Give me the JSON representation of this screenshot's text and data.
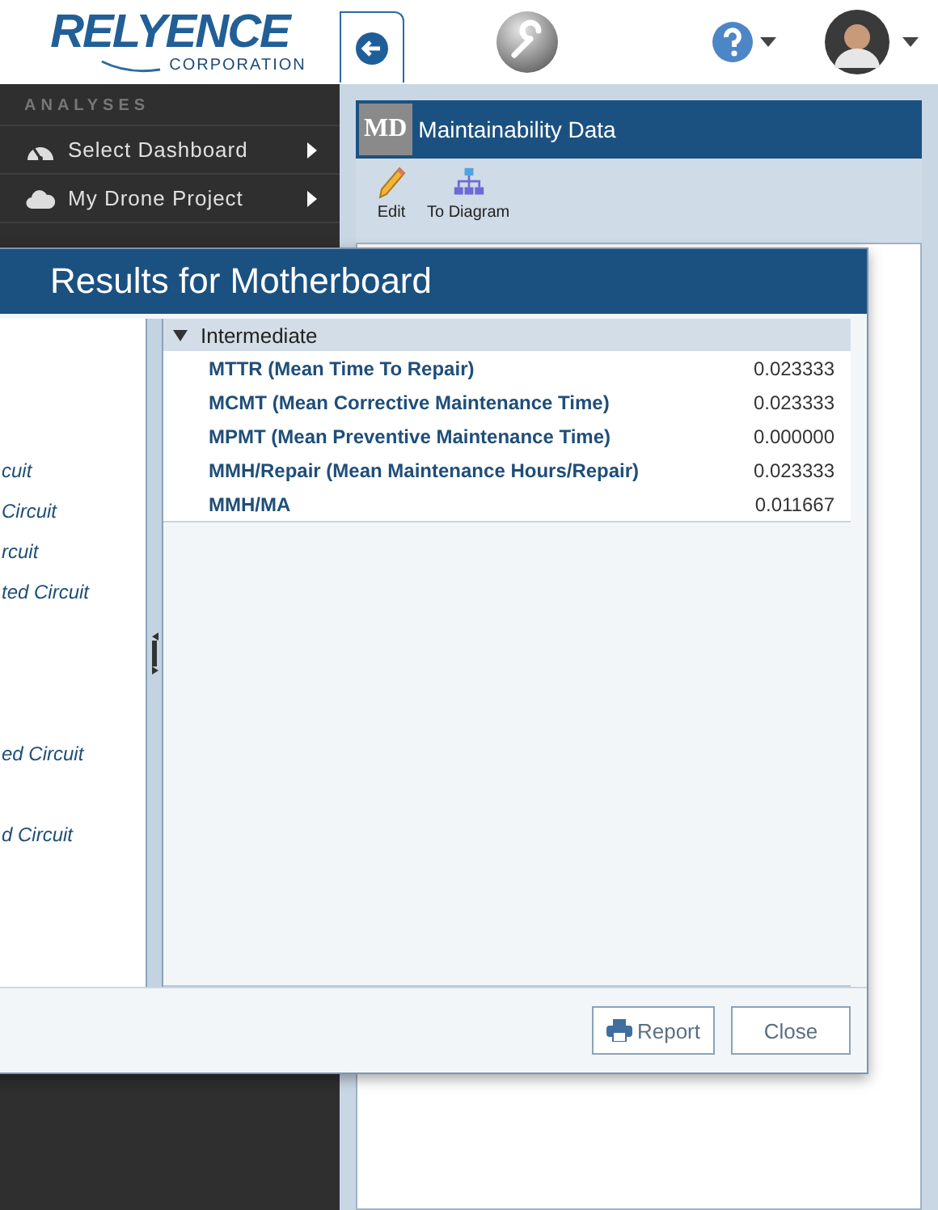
{
  "header": {
    "logo": "RELYENCE",
    "logo_sub": "CORPORATION"
  },
  "sidebar": {
    "sections": [
      {
        "title": "ANALYSES",
        "items": [
          {
            "label": "Select Dashboard"
          },
          {
            "label": "My Drone Project"
          }
        ]
      }
    ]
  },
  "panel": {
    "badge": "MD",
    "title": "Maintainability Data",
    "tools": [
      {
        "label": "Edit"
      },
      {
        "label": "To Diagram"
      }
    ]
  },
  "dialog": {
    "title": "Results for Motherboard",
    "tree_items": [
      "cuit",
      "Circuit",
      "rcuit",
      "ted Circuit",
      "ed Circuit",
      "d Circuit"
    ],
    "group": {
      "label": "Intermediate",
      "expanded": true,
      "rows": [
        {
          "name": "MTTR (Mean Time To Repair)",
          "value": "0.023333"
        },
        {
          "name": "MCMT (Mean Corrective Maintenance Time)",
          "value": "0.023333"
        },
        {
          "name": "MPMT (Mean Preventive Maintenance Time)",
          "value": "0.000000"
        },
        {
          "name": "MMH/Repair (Mean Maintenance Hours/Repair)",
          "value": "0.023333"
        },
        {
          "name": "MMH/MA",
          "value": "0.011667"
        }
      ]
    },
    "buttons": [
      {
        "label": "Report",
        "kind": "icon"
      },
      {
        "label": "Close",
        "kind": "plain"
      }
    ]
  }
}
